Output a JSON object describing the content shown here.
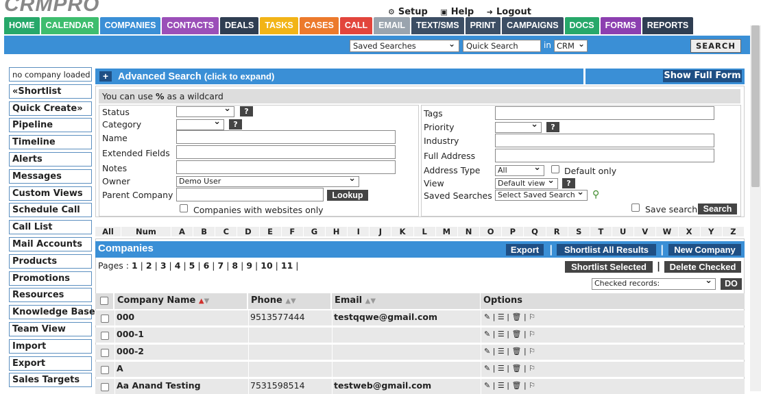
{
  "app": {
    "logo": "CRMPRO"
  },
  "toplinks": [
    {
      "icon": "⚙",
      "label": "Setup"
    },
    {
      "icon": "▣",
      "label": "Help"
    },
    {
      "icon": "➜",
      "label": "Logout"
    }
  ],
  "nav": [
    {
      "label": "HOME",
      "color": "#27a86a"
    },
    {
      "label": "CALENDAR",
      "color": "#3ebd6e"
    },
    {
      "label": "COMPANIES",
      "color": "#3a8fd6"
    },
    {
      "label": "CONTACTS",
      "color": "#9b4fb8"
    },
    {
      "label": "DEALS",
      "color": "#2f3e52"
    },
    {
      "label": "TASKS",
      "color": "#f2b417"
    },
    {
      "label": "CASES",
      "color": "#ec7a2c"
    },
    {
      "label": "CALL",
      "color": "#e2453c"
    },
    {
      "label": "EMAIL",
      "color": "#9aa4ae"
    },
    {
      "label": "TEXT/SMS",
      "color": "#3c4e64"
    },
    {
      "label": "PRINT",
      "color": "#3c4e64"
    },
    {
      "label": "CAMPAIGNS",
      "color": "#3c4e64"
    },
    {
      "label": "DOCS",
      "color": "#27a86a"
    },
    {
      "label": "FORMS",
      "color": "#8c3fb0"
    },
    {
      "label": "REPORTS",
      "color": "#2f3e52"
    }
  ],
  "searchbar": {
    "saved_searches": "Saved Searches",
    "quick_search": "Quick Search",
    "in_label": "in",
    "scope": "CRM",
    "button": "SEARCH"
  },
  "sidebar": [
    "no company loaded",
    "«Shortlist",
    "Quick Create»",
    "Pipeline",
    "Timeline",
    "Alerts",
    "Messages",
    "Custom Views",
    "Schedule Call",
    "Call List",
    "Mail Accounts",
    "Products",
    "Promotions",
    "Resources",
    "Knowledge Base",
    "Team View",
    "Import",
    "Export",
    "Sales Targets"
  ],
  "advanced": {
    "plus": "+",
    "title": "Advanced Search",
    "subtitle": "(click to expand)",
    "show_full": "Show Full Form",
    "wildcard_pre": "You can use ",
    "wildcard_sym": "%",
    "wildcard_post": " as a wildcard",
    "left": {
      "status": "Status",
      "category": "Category",
      "name": "Name",
      "extended": "Extended Fields",
      "notes": "Notes",
      "owner": "Owner",
      "owner_value": "Demo User",
      "parent": "Parent Company",
      "lookup": "Lookup",
      "websites": "Companies with websites only"
    },
    "right": {
      "tags": "Tags",
      "priority": "Priority",
      "industry": "Industry",
      "full_address": "Full Address",
      "address_type": "Address Type",
      "address_type_value": "All",
      "default_only": "Default only",
      "view": "View",
      "view_value": "Default view",
      "saved_searches": "Saved Searches",
      "saved_value": "Select Saved Search",
      "save_search": "Save search",
      "search_btn": "Search"
    },
    "help": "?"
  },
  "alphabet": [
    "All",
    "Num",
    "A",
    "B",
    "C",
    "D",
    "E",
    "F",
    "G",
    "H",
    "I",
    "J",
    "K",
    "L",
    "M",
    "N",
    "O",
    "P",
    "Q",
    "R",
    "S",
    "T",
    "U",
    "V",
    "W",
    "X",
    "Y",
    "Z"
  ],
  "companies": {
    "title": "Companies",
    "export": "Export",
    "shortlist_all": "Shortlist All Results",
    "new_company": "New Company",
    "pages_label": "Pages :",
    "pages": [
      "1",
      "2",
      "3",
      "4",
      "5",
      "6",
      "7",
      "8",
      "9",
      "10",
      "11"
    ],
    "shortlist_selected": "Shortlist Selected",
    "delete_checked": "Delete Checked",
    "checked_records": "Checked records:",
    "do": "DO",
    "columns": {
      "name": "Company Name",
      "phone": "Phone",
      "email": "Email",
      "options": "Options"
    },
    "rows": [
      {
        "name": "000",
        "phone": "9513577444",
        "email": "testqqwe@gmail.com"
      },
      {
        "name": "000-1",
        "phone": "",
        "email": ""
      },
      {
        "name": "000-2",
        "phone": "",
        "email": ""
      },
      {
        "name": "A",
        "phone": "",
        "email": ""
      },
      {
        "name": "Aa Anand Testing",
        "phone": "7531598514",
        "email": "testweb@gmail.com"
      }
    ],
    "options_glyphs": "✎ | ☰ | 🗑 | ⚐"
  }
}
